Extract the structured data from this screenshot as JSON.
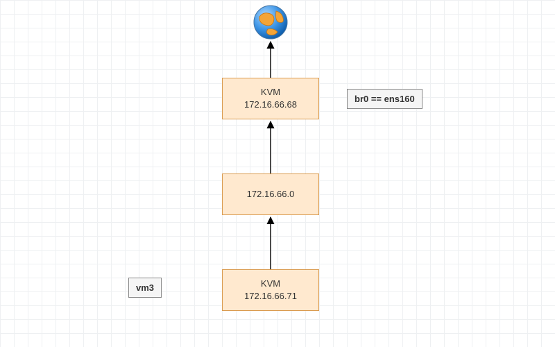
{
  "globe": {
    "name": "globe-icon"
  },
  "nodes": {
    "kvm_host": {
      "title": "KVM",
      "ip": "172.16.66.68"
    },
    "subnet": {
      "title": "",
      "ip": "172.16.66.0"
    },
    "kvm_vm": {
      "title": "KVM",
      "ip": "172.16.66.71"
    }
  },
  "labels": {
    "bridge": "br0 == ens160",
    "vm": "vm3"
  },
  "colors": {
    "node_fill": "#ffe9cf",
    "node_border": "#d99a4e",
    "label_fill": "#f5f5f5",
    "label_border": "#888"
  }
}
